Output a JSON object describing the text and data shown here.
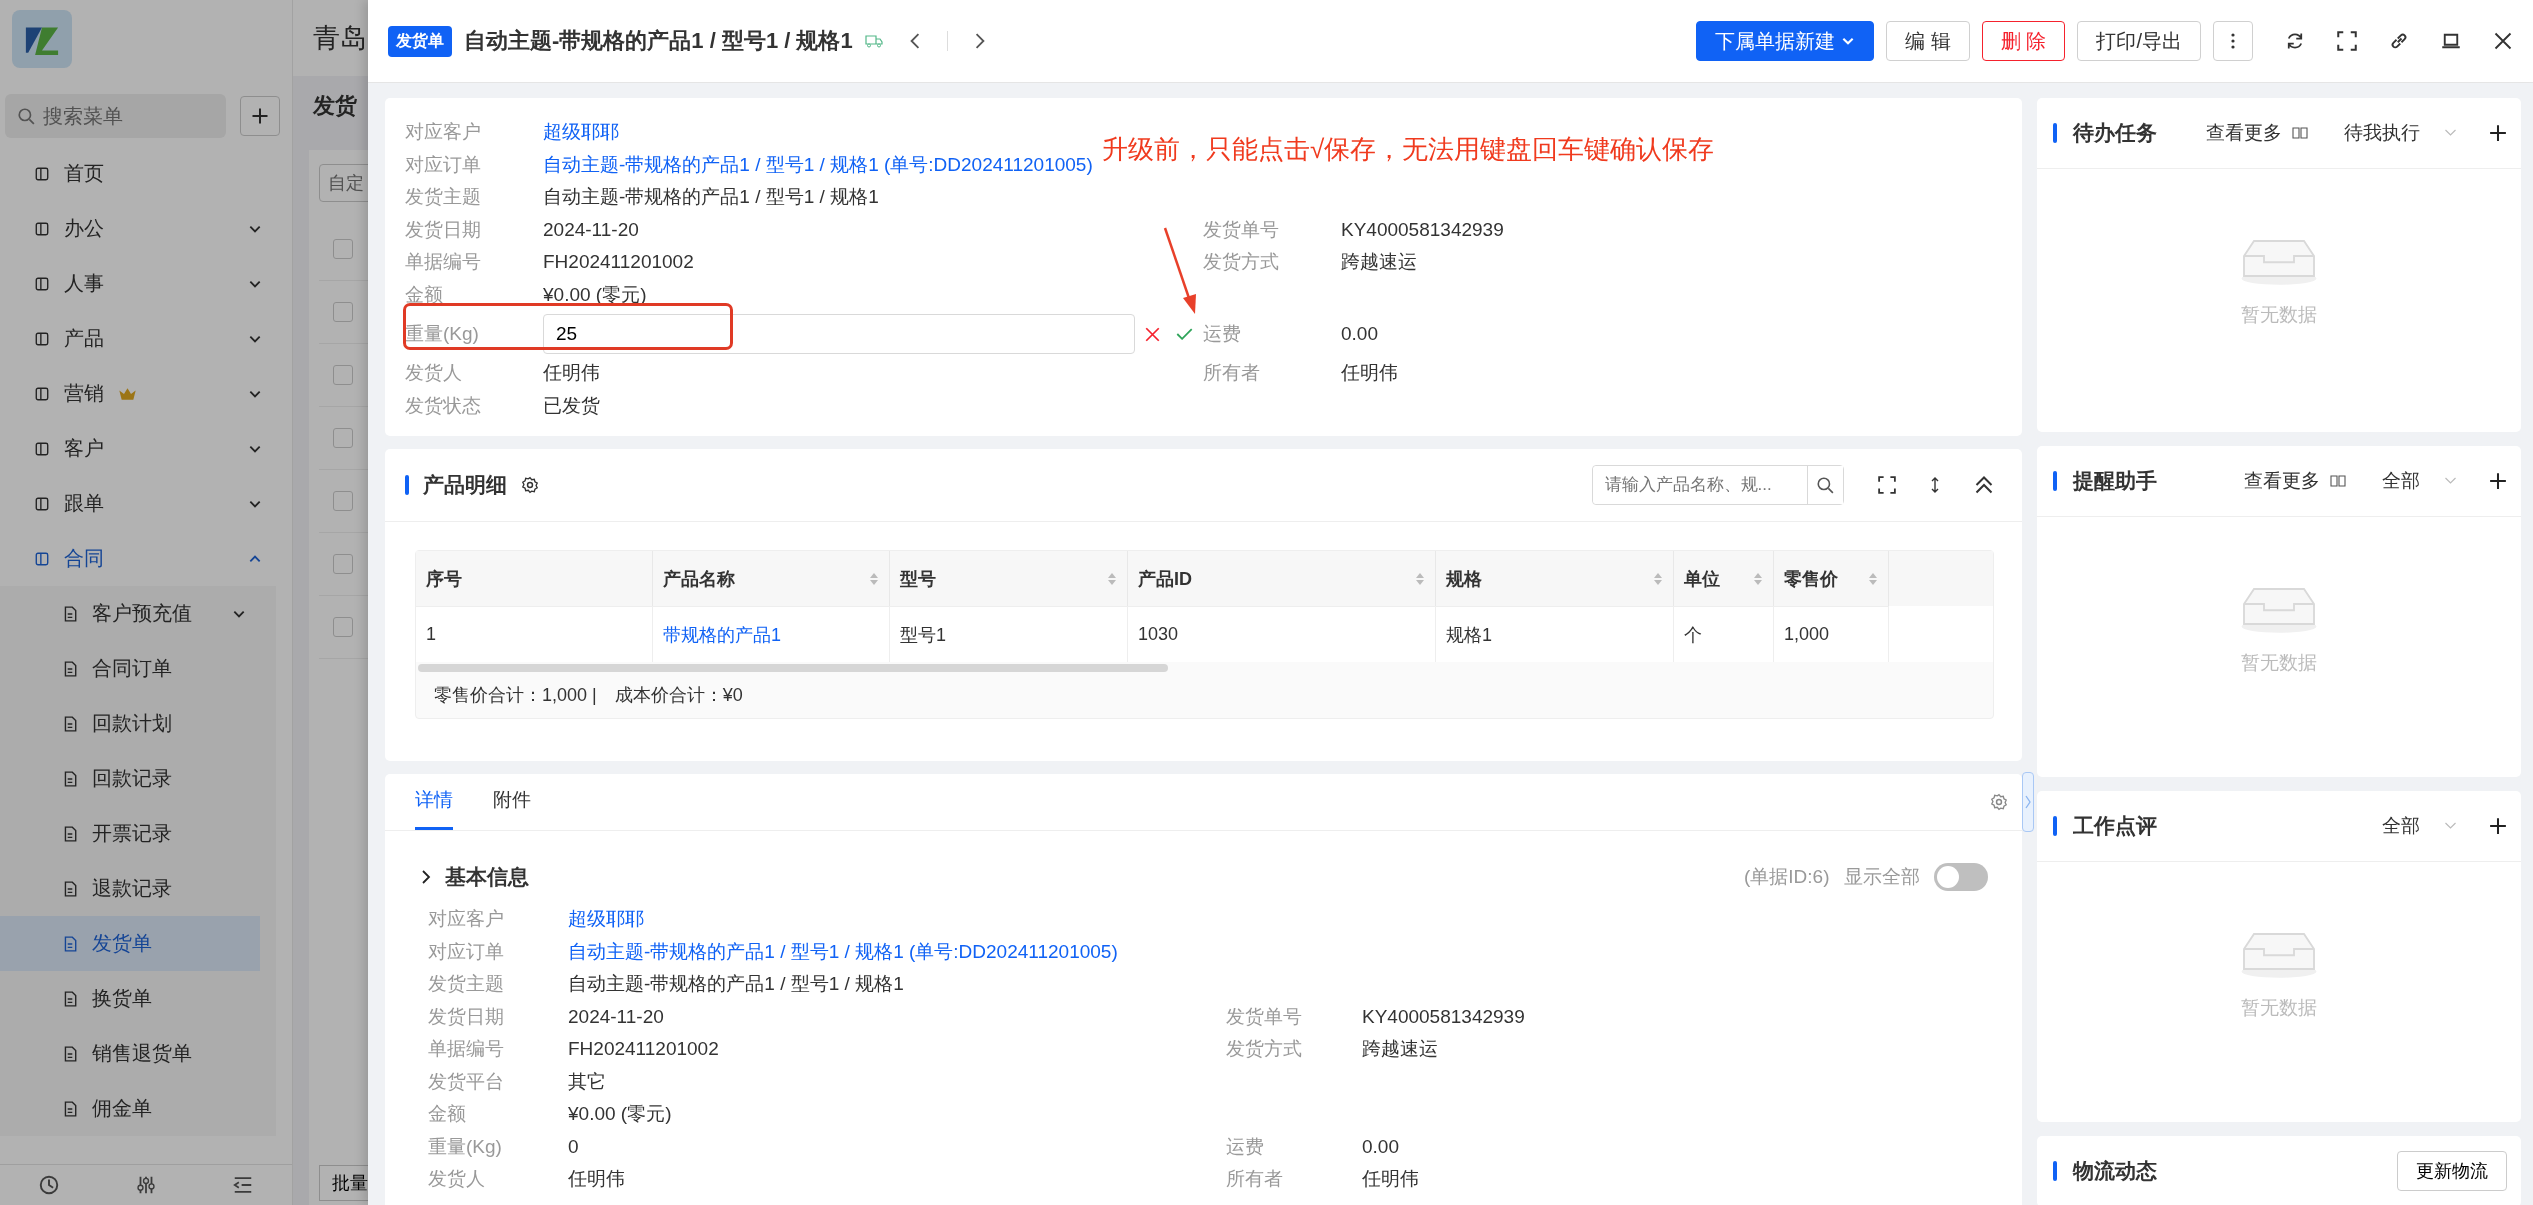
{
  "app": {
    "company": "青岛",
    "page_title": "发货",
    "filter_placeholder": "自定",
    "batch_button": "批量",
    "rows": [
      {
        "checked": false
      },
      {
        "checked": false
      },
      {
        "checked": false
      },
      {
        "checked": false
      },
      {
        "checked": false
      },
      {
        "checked": false
      },
      {
        "checked": false
      }
    ]
  },
  "sidebar": {
    "search_placeholder": "搜索菜单",
    "items": [
      {
        "label": "首页",
        "selected": false
      },
      {
        "label": "办公",
        "selected": false,
        "expanded": false
      },
      {
        "label": "人事",
        "selected": false,
        "expanded": false
      },
      {
        "label": "产品",
        "selected": false,
        "expanded": false
      },
      {
        "label": "营销",
        "selected": false,
        "expanded": false,
        "premium": true
      },
      {
        "label": "客户",
        "selected": false,
        "expanded": false
      },
      {
        "label": "跟单",
        "selected": false,
        "expanded": false
      },
      {
        "label": "合同",
        "selected": false,
        "expanded": true,
        "children": [
          {
            "label": "客户预充值",
            "selected": false,
            "expanded": false
          },
          {
            "label": "合同订单",
            "selected": false
          },
          {
            "label": "回款计划",
            "selected": false
          },
          {
            "label": "回款记录",
            "selected": false
          },
          {
            "label": "开票记录",
            "selected": false
          },
          {
            "label": "退款记录",
            "selected": false
          },
          {
            "label": "发货单",
            "selected": true
          },
          {
            "label": "换货单",
            "selected": false
          },
          {
            "label": "销售退货单",
            "selected": false
          },
          {
            "label": "佣金单",
            "selected": false
          }
        ]
      }
    ]
  },
  "drawer": {
    "badge": "发货单",
    "title": "自动主题-带规格的产品1 / 型号1 / 规格1",
    "buttons": [
      {
        "label": "下属单据新建",
        "kind": "primary"
      },
      {
        "label": "编 辑",
        "kind": "default"
      },
      {
        "label": "删 除",
        "kind": "danger"
      },
      {
        "label": "打印/导出",
        "kind": "default"
      }
    ]
  },
  "info": {
    "annotation": "升级前，只能点击√保存，无法用键盘回车键确认保存",
    "rows": [
      {
        "label": "对应客户",
        "value": "超级耶耶",
        "kind": "link"
      },
      {
        "label": "对应订单",
        "value": "自动主题-带规格的产品1 / 型号1 / 规格1 (单号:DD202411201005)",
        "kind": "link"
      },
      {
        "label": "发货主题",
        "value": "自动主题-带规格的产品1 / 型号1 / 规格1",
        "kind": "text"
      },
      {
        "label": "发货日期",
        "value": "2024-11-20",
        "kind": "text",
        "pair": {
          "label": "发货单号",
          "value": "KY4000581342939"
        }
      },
      {
        "label": "单据编号",
        "value": "FH202411201002",
        "kind": "text",
        "pair": {
          "label": "发货方式",
          "value": "跨越速运"
        }
      },
      {
        "label": "金额",
        "value": "¥0.00 (零元)",
        "kind": "text"
      },
      {
        "label": "重量(Kg)",
        "value": "25",
        "kind": "input",
        "pair": {
          "label": "运费",
          "value": "0.00"
        }
      },
      {
        "label": "发货人",
        "value": "任明伟",
        "kind": "text",
        "pair": {
          "label": "所有者",
          "value": "任明伟"
        }
      },
      {
        "label": "发货状态",
        "value": "已发货",
        "kind": "text"
      }
    ]
  },
  "products": {
    "title": "产品明细",
    "search_placeholder": "请输入产品名称、规...",
    "columns": [
      {
        "label": "序号",
        "sortable": false
      },
      {
        "label": "产品名称",
        "sortable": true
      },
      {
        "label": "型号",
        "sortable": true
      },
      {
        "label": "产品ID",
        "sortable": true
      },
      {
        "label": "规格",
        "sortable": true
      },
      {
        "label": "单位",
        "sortable": true
      },
      {
        "label": "零售价",
        "sortable": true
      }
    ],
    "rows": [
      {
        "cells": [
          {
            "text": "1",
            "link": false
          },
          {
            "text": "带规格的产品1",
            "link": true
          },
          {
            "text": "型号1",
            "link": false
          },
          {
            "text": "1030",
            "link": false
          },
          {
            "text": "规格1",
            "link": false
          },
          {
            "text": "个",
            "link": false
          },
          {
            "text": "1,000",
            "link": false
          }
        ]
      }
    ],
    "summary": [
      "零售价合计：1,000 |",
      "成本价合计：¥0"
    ]
  },
  "details": {
    "tabs": [
      {
        "label": "详情",
        "selected": true
      },
      {
        "label": "附件",
        "selected": false
      }
    ],
    "section": "基本信息",
    "doc_id": "(单据ID:6)",
    "show_all": {
      "label": "显示全部",
      "on": false
    },
    "rows": [
      {
        "label": "对应客户",
        "value": "超级耶耶",
        "kind": "link"
      },
      {
        "label": "对应订单",
        "value": "自动主题-带规格的产品1 / 型号1 / 规格1 (单号:DD202411201005)",
        "kind": "link"
      },
      {
        "label": "发货主题",
        "value": "自动主题-带规格的产品1 / 型号1 / 规格1",
        "kind": "text"
      },
      {
        "label": "发货日期",
        "value": "2024-11-20",
        "kind": "text",
        "pair": {
          "label": "发货单号",
          "value": "KY4000581342939"
        }
      },
      {
        "label": "单据编号",
        "value": "FH202411201002",
        "kind": "text",
        "pair": {
          "label": "发货方式",
          "value": "跨越速运"
        }
      },
      {
        "label": "发货平台",
        "value": "其它",
        "kind": "text"
      },
      {
        "label": "金额",
        "value": "¥0.00 (零元)",
        "kind": "text"
      },
      {
        "label": "重量(Kg)",
        "value": "0",
        "kind": "text",
        "pair": {
          "label": "运费",
          "value": "0.00"
        }
      },
      {
        "label": "发货人",
        "value": "任明伟",
        "kind": "text",
        "pair": {
          "label": "所有者",
          "value": "任明伟"
        }
      }
    ]
  },
  "panels": [
    {
      "title": "待办任务",
      "more": "查看更多",
      "filter": "待我执行",
      "empty": "暂无数据"
    },
    {
      "title": "提醒助手",
      "more": "查看更多",
      "filter": "全部",
      "empty": "暂无数据"
    },
    {
      "title": "工作点评",
      "filter": "全部",
      "empty": "暂无数据"
    },
    {
      "title": "物流动态",
      "action": "更新物流"
    }
  ]
}
